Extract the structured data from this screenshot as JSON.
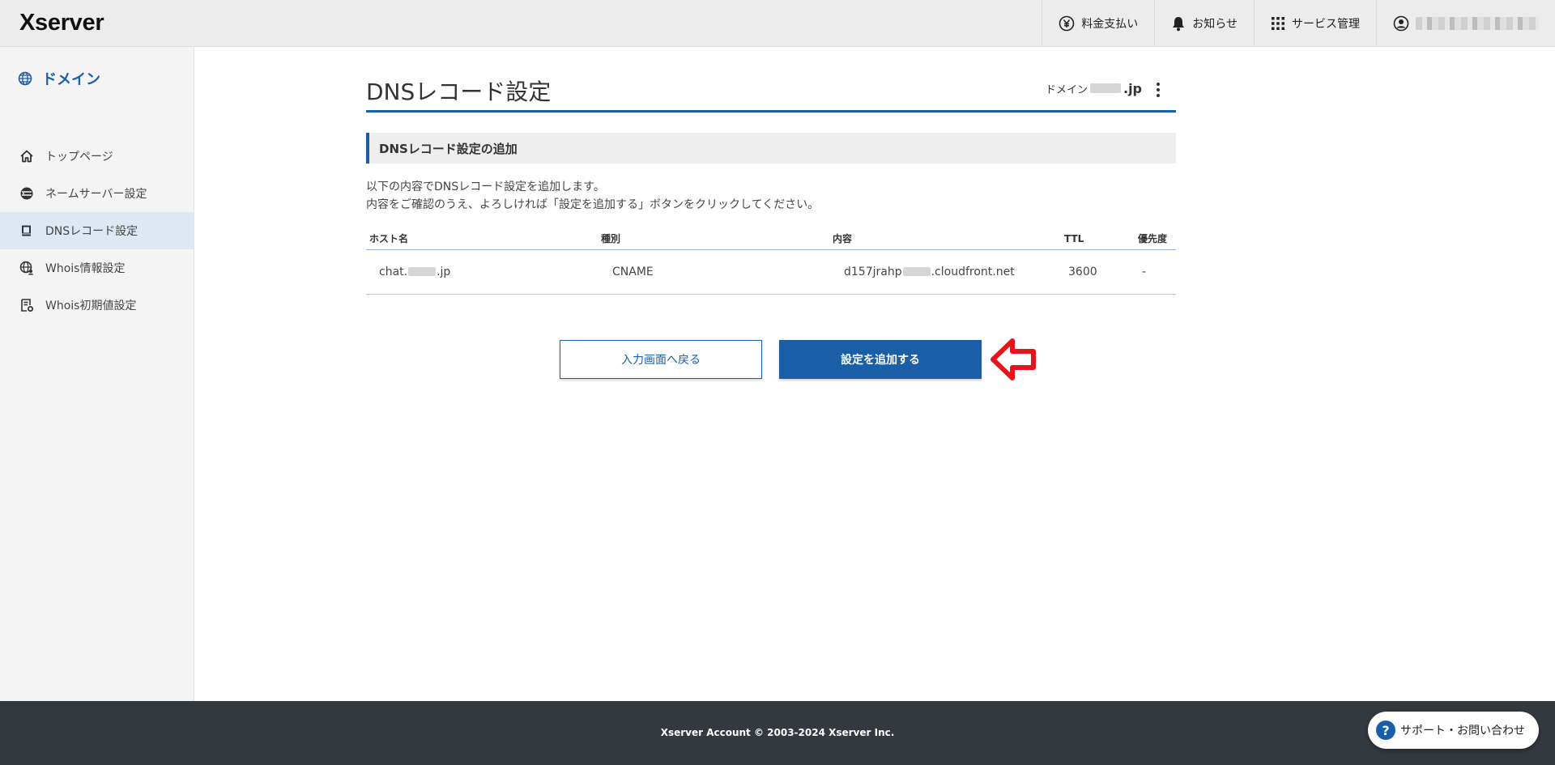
{
  "header": {
    "logo": "Xserver",
    "nav": [
      {
        "label": "料金支払い",
        "icon": "yen-circle-icon"
      },
      {
        "label": "お知らせ",
        "icon": "bell-icon"
      },
      {
        "label": "サービス管理",
        "icon": "grid-icon"
      }
    ]
  },
  "sidebar": {
    "title": "ドメイン",
    "items": [
      {
        "label": "トップページ",
        "icon": "home-icon"
      },
      {
        "label": "ネームサーバー設定",
        "icon": "server-globe-icon"
      },
      {
        "label": "DNSレコード設定",
        "icon": "book-icon"
      },
      {
        "label": "Whois情報設定",
        "icon": "globe-person-icon"
      },
      {
        "label": "Whois初期値設定",
        "icon": "document-gear-icon"
      }
    ]
  },
  "main": {
    "title": "DNSレコード設定",
    "domain_prefix": "ドメイン",
    "domain_tld": ".jp",
    "section_title": "DNSレコード設定の追加",
    "desc_line1": "以下の内容でDNSレコード設定を追加します。",
    "desc_line2": "内容をご確認のうえ、よろしければ「設定を追加する」ボタンをクリックしてください。",
    "table": {
      "headers": [
        "ホスト名",
        "種別",
        "内容",
        "TTL",
        "優先度"
      ],
      "row": {
        "host_prefix": "chat.",
        "host_suffix": ".jp",
        "type": "CNAME",
        "content_prefix": "d157jrahp",
        "content_suffix": ".cloudfront.net",
        "ttl": "3600",
        "priority": "-"
      }
    },
    "back_button": "入力画面へ戻る",
    "add_button": "設定を追加する"
  },
  "footer": {
    "copyright": "Xserver Account © 2003-2024 Xserver Inc.",
    "support": "サポート・お問い合わせ"
  },
  "colors": {
    "accent": "#1a5ea8",
    "arrow": "#e8141b",
    "footer": "#34383f"
  }
}
